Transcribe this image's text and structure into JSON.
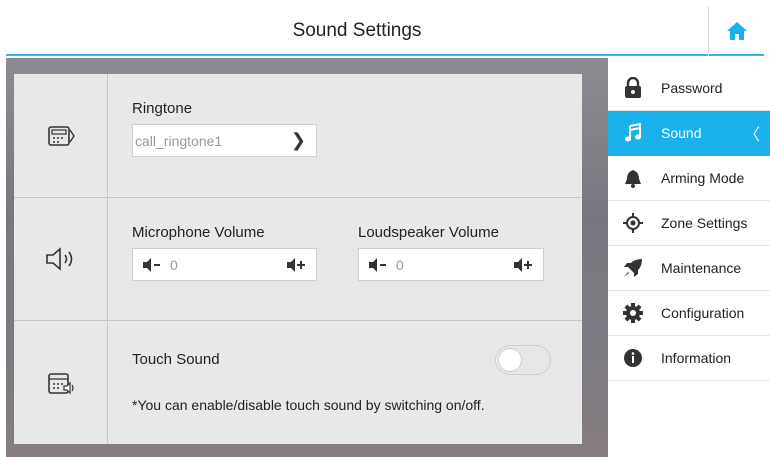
{
  "header": {
    "title": "Sound Settings"
  },
  "ringtone": {
    "label": "Ringtone",
    "value": "call_ringtone1"
  },
  "volume": {
    "mic_label": "Microphone Volume",
    "mic_value": "0",
    "speaker_label": "Loudspeaker Volume",
    "speaker_value": "0"
  },
  "touch_sound": {
    "label": "Touch Sound",
    "note": "*You can enable/disable touch sound by switching on/off.",
    "enabled": false
  },
  "sidebar": {
    "items": [
      {
        "label": "Password",
        "icon": "lock-icon"
      },
      {
        "label": "Sound",
        "icon": "music-note-icon",
        "active": true
      },
      {
        "label": "Arming Mode",
        "icon": "bell-icon"
      },
      {
        "label": "Zone Settings",
        "icon": "crosshair-icon"
      },
      {
        "label": "Maintenance",
        "icon": "rocket-icon"
      },
      {
        "label": "Configuration",
        "icon": "gear-icon"
      },
      {
        "label": "Information",
        "icon": "info-icon"
      }
    ]
  },
  "colors": {
    "accent": "#1ab0ec",
    "header_line": "#33b5e5"
  }
}
